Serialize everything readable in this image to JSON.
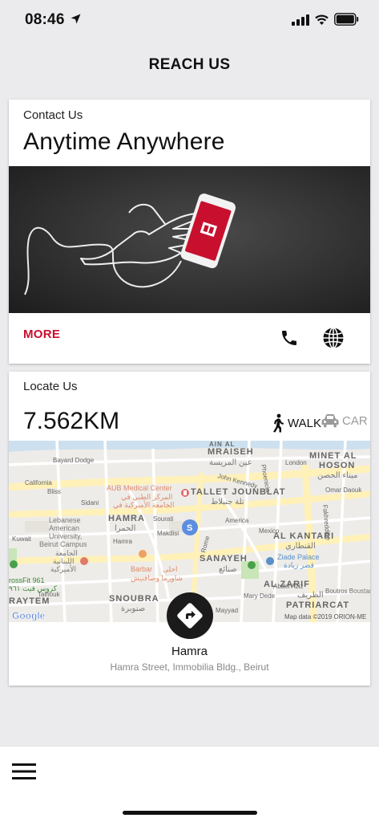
{
  "status_bar": {
    "time": "08:46"
  },
  "header": {
    "title": "REACH US"
  },
  "contact_card": {
    "subtitle": "Contact Us",
    "headline": "Anytime Anywhere",
    "more_label": "MORE"
  },
  "locate_card": {
    "subtitle": "Locate Us",
    "distance": "7.562KM",
    "walk_label": "WALK",
    "car_label": "CAR",
    "location_name": "Hamra",
    "location_address": "Hamra Street, Immobilia Bldg., Beirut"
  },
  "map": {
    "labels": {
      "mraiseh": "MRAISEH",
      "mraiseh_ar": "عين المريسة",
      "minet": "MINET AL",
      "hoson": "HOSON",
      "minet_ar": "ميناء الحصن",
      "bayard": "Bayard Dodge",
      "california": "California",
      "john_kennedy": "John Kennedy",
      "london": "London",
      "omar_daouk": "Omar Daouk",
      "fakhreddine": "Fakhreddine",
      "phoenicia": "Phoenicia",
      "aub": "AUB Medical Center",
      "aub_ar1": "المركز الطبي في",
      "aub_ar2": "الجامعة الأميركية في",
      "tallet": "TALLET JOUNBLAT",
      "tallet_ar": "تلة جنبلاط",
      "bliss": "Bliss",
      "sidani": "Sidani",
      "hamra_caps": "HAMRA",
      "hamra_ar": "الحمرا",
      "hamra": "Hamra",
      "sourati": "Sourati",
      "makdisi": "Makdisi",
      "america": "America",
      "mexico": "Mexico",
      "kantari": "AL KANTARI",
      "kantari_ar": "القنطاري",
      "lebanese1": "Lebanese",
      "lebanese2": "American",
      "lebanese3": "University,",
      "lebanese4": "Beirut Campus",
      "lau_ar1": "الجامعة",
      "lau_ar2": "اللبنانية",
      "lau_ar3": "الأميركية",
      "kuwait": "Kuwait",
      "rome": "Rome",
      "sanayeh": "SANAYEH",
      "sanayeh_ar": "صنائع",
      "ziade": "Ziade Palace",
      "ziade_ar": "قصر زيادة",
      "crossfit": "rossFit 961",
      "crossfit_ar": "كروس فيت ٩٦١",
      "barbar": "Barbar",
      "barbar_ar1": "احلى",
      "barbar_ar2": "شاورما وصافنيش",
      "zarif": "AL ZARIF",
      "zarif_ar": "الظريف",
      "raytem": "RAYTEM",
      "talhouk": "Talhouk",
      "snoubra": "SNOUBRA",
      "snoubra_ar": "صنوبرة",
      "mary_dede": "Mary Dede",
      "patriarcat": "PATRIARCAT",
      "boutros": "Boutros Boustani",
      "abdel": "Abdel Aziz",
      "mayyad": "Mayyad",
      "google": "Google",
      "credit": "Map data ©2019 ORION-ME",
      "ain_al": "AIN AL"
    }
  },
  "tab_bar": {}
}
